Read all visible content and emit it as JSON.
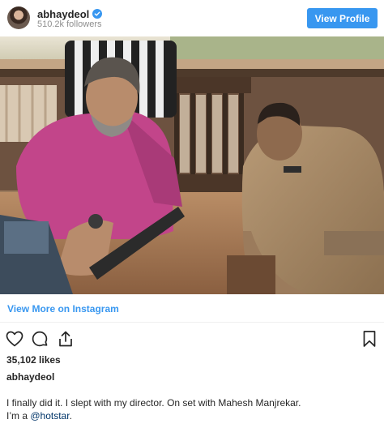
{
  "header": {
    "username": "abhaydeol",
    "followers": "510.2k followers",
    "view_profile_label": "View Profile"
  },
  "post": {
    "view_more_label": "View More on Instagram",
    "likes": "35,102 likes",
    "caption_username": "abhaydeol",
    "caption_line1": "I finally did it. I slept with my director. On set with Mahesh Manjrekar.",
    "caption_line2_prefix": "I’m a ",
    "caption_mention": "@hotstar",
    "caption_line2_suffix": "."
  },
  "icons": {
    "verified": "verified-badge-icon",
    "like": "heart-icon",
    "comment": "comment-icon",
    "share": "share-icon",
    "save": "bookmark-icon"
  },
  "colors": {
    "accent": "#3897f0",
    "text": "#262626",
    "muted": "#8e8e8e",
    "mention": "#003569"
  }
}
